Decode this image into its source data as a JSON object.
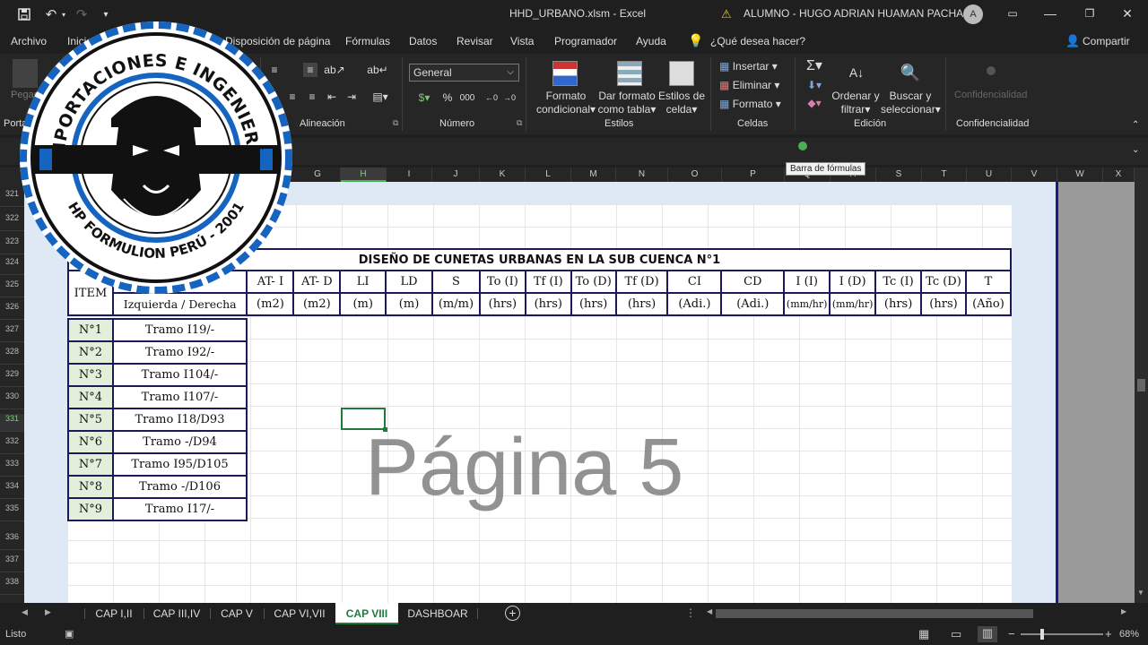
{
  "titlebar": {
    "filename": "HHD_URBANO.xlsm",
    "app": "Excel",
    "separator": "-",
    "user": "ALUMNO - HUGO ADRIAN HUAMAN PACHARI",
    "avatar": "A",
    "save_icon": "save-icon",
    "undo_icon": "undo-icon",
    "redo_icon": "redo-icon"
  },
  "menu": {
    "items": [
      "Archivo",
      "Inicio",
      "Disposición de página",
      "Fórmulas",
      "Datos",
      "Revisar",
      "Vista",
      "Programador",
      "Ayuda"
    ],
    "tell_me": "¿Qué desea hacer?",
    "share": "Compartir"
  },
  "ribbon": {
    "paste": "Pegar",
    "portapapeles": "Porta",
    "alineacion": "Alineación",
    "number_format": "General",
    "numero": "Número",
    "cond_format": [
      "Formato",
      "condicional"
    ],
    "table_format": [
      "Dar formato",
      "como tabla"
    ],
    "cell_styles": [
      "Estilos de",
      "celda"
    ],
    "estilos": "Estilos",
    "insert": "Insertar",
    "delete": "Eliminar",
    "format": "Formato",
    "celdas": "Celdas",
    "sort": [
      "Ordenar y",
      "filtrar"
    ],
    "find": [
      "Buscar y",
      "seleccionar"
    ],
    "edicion": "Edición",
    "conf_btn": "Confidencialidad",
    "confidencialidad": "Confidencialidad"
  },
  "formula_tooltip": "Barra de fórmulas",
  "columns": [
    "G",
    "H",
    "I",
    "J",
    "K",
    "L",
    "M",
    "N",
    "O",
    "P",
    "Q",
    "R",
    "S",
    "T",
    "U",
    "V",
    "W",
    "X"
  ],
  "rows": [
    "321",
    "322",
    "323",
    "324",
    "325",
    "326",
    "327",
    "328",
    "329",
    "330",
    "331",
    "332",
    "333",
    "334",
    "335",
    "336",
    "337",
    "338"
  ],
  "logo": {
    "top_text": "IMPORTACIONES E INGENIERÍA",
    "bottom_text": "HP FORMULION PERÚ - 2001"
  },
  "watermark": "Página 5",
  "table": {
    "title": "DISEÑO DE CUNETAS URBANAS EN LA SUB CUENCA N°1",
    "item_header": "ITEM",
    "tramo_subheader": "Izquierda / Derecha",
    "headers": [
      "AT- I",
      "AT- D",
      "LI",
      "LD",
      "S",
      "To (I)",
      "Tf (I)",
      "To (D)",
      "Tf (D)",
      "CI",
      "CD",
      "I (I)",
      "I (D)",
      "Tc (I)",
      "Tc (D)",
      "T"
    ],
    "units": [
      "(m2)",
      "(m2)",
      "(m)",
      "(m)",
      "(m/m)",
      "(hrs)",
      "(hrs)",
      "(hrs)",
      "(hrs)",
      "(Adi.)",
      "(Adi.)",
      "(mm/hr)",
      "(mm/hr)",
      "(hrs)",
      "(hrs)",
      "(Año)"
    ],
    "rows": [
      {
        "n": "N°1",
        "tramo": "Tramo I19/-"
      },
      {
        "n": "N°2",
        "tramo": "Tramo I92/-"
      },
      {
        "n": "N°3",
        "tramo": "Tramo I104/-"
      },
      {
        "n": "N°4",
        "tramo": "Tramo I107/-"
      },
      {
        "n": "N°5",
        "tramo": "Tramo I18/D93"
      },
      {
        "n": "N°6",
        "tramo": "Tramo -/D94"
      },
      {
        "n": "N°7",
        "tramo": "Tramo I95/D105"
      },
      {
        "n": "N°8",
        "tramo": "Tramo -/D106"
      },
      {
        "n": "N°9",
        "tramo": "Tramo I17/-"
      }
    ]
  },
  "sheet_tabs": [
    "CAP I,II",
    "CAP III,IV",
    "CAP V",
    "CAP VI,VII",
    "CAP VIII",
    "DASHBOAR"
  ],
  "active_tab": "CAP VIII",
  "status": {
    "ready": "Listo",
    "zoom": "68%"
  },
  "colors": {
    "accent_green": "#4caf50",
    "table_border": "#1a1a5a",
    "item_fill": "#e2efda",
    "logo_blue": "#1565c0"
  }
}
